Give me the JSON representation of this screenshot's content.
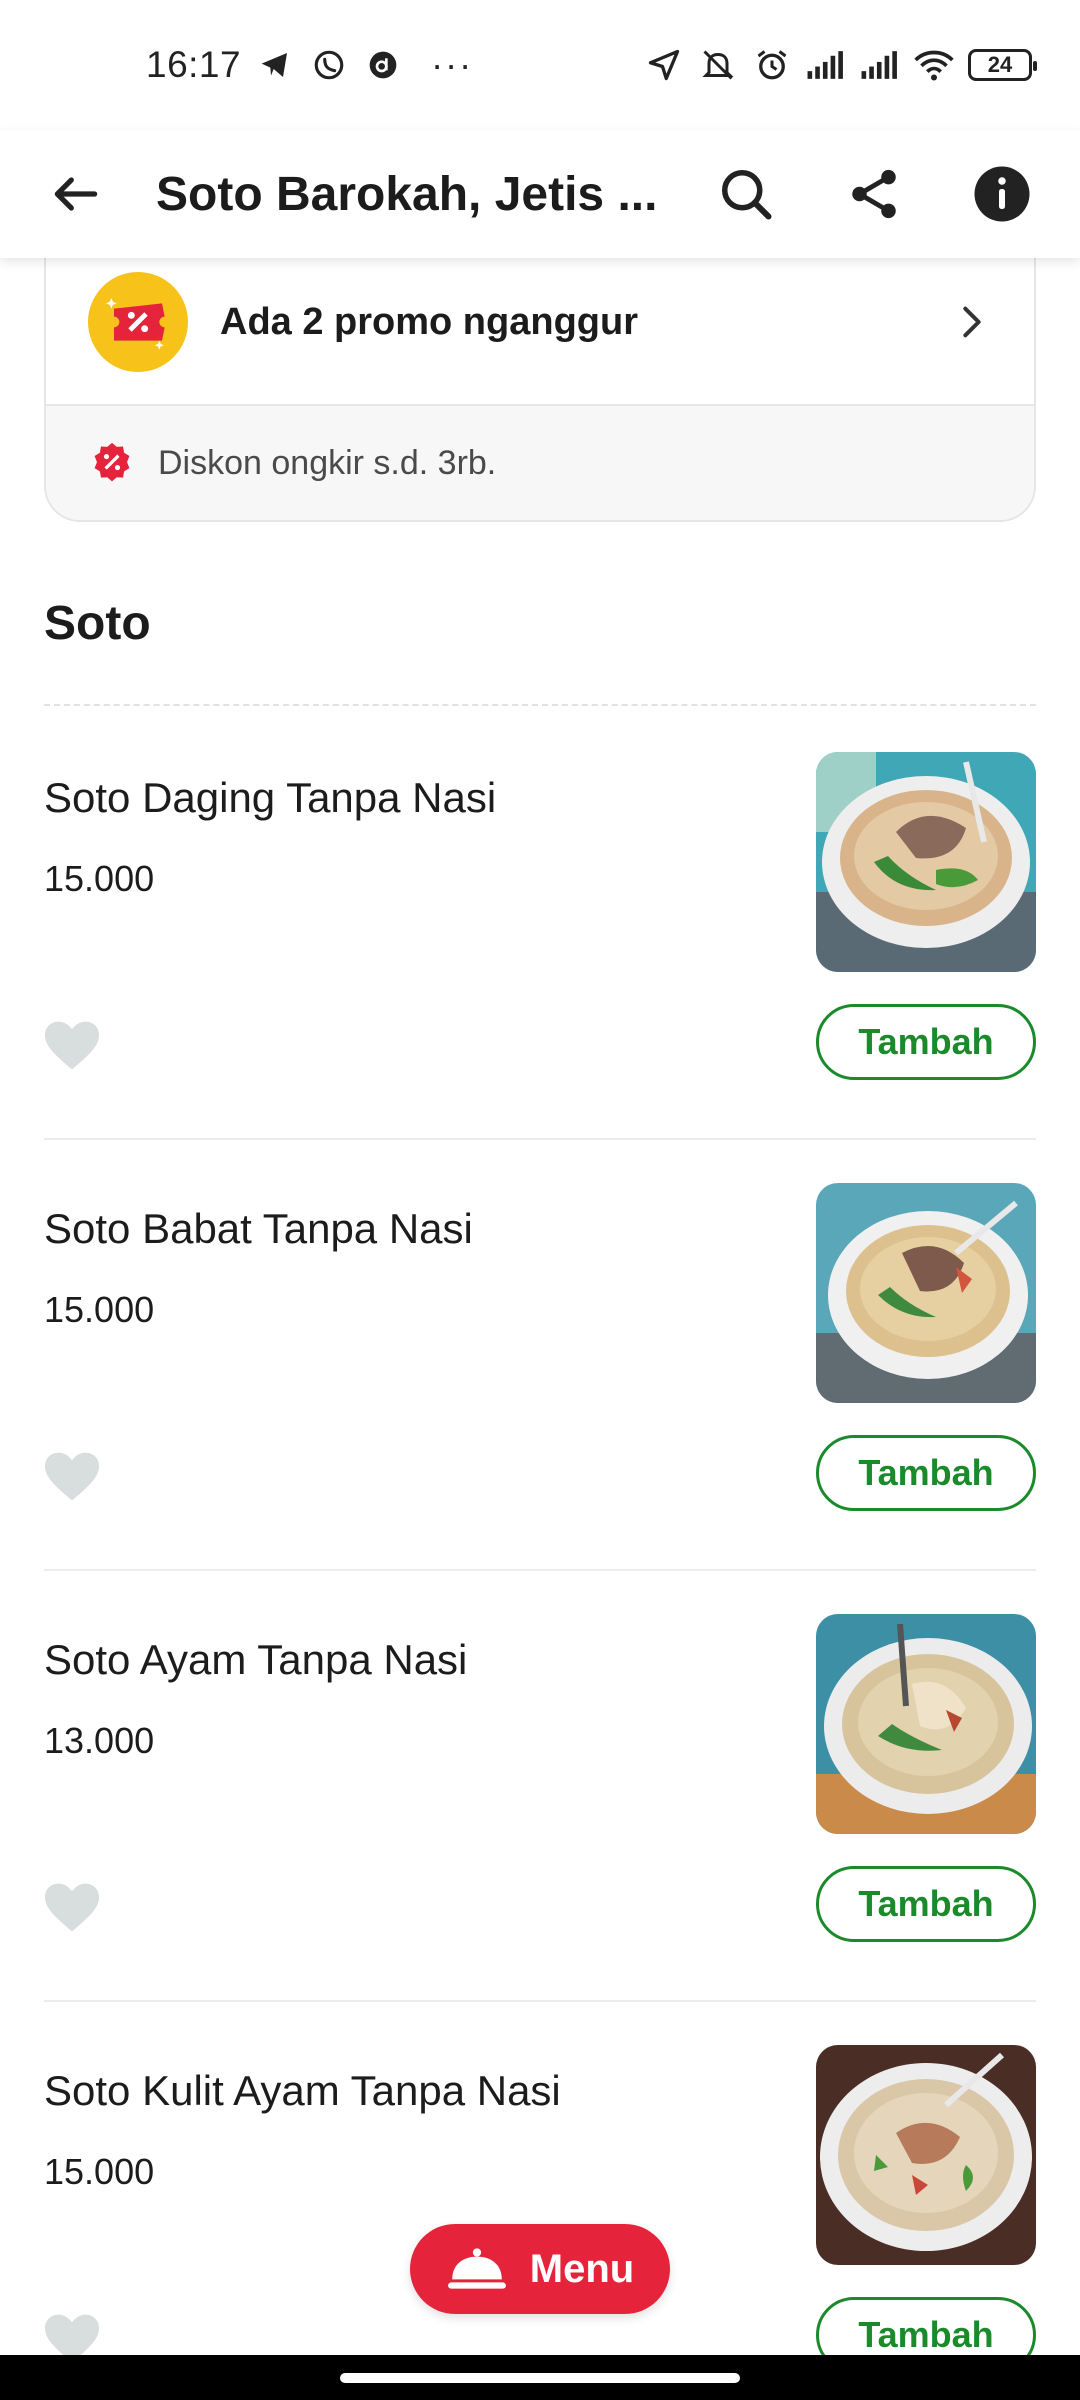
{
  "status_bar": {
    "time": "16:17",
    "notification_icons": [
      "telegram-icon",
      "whatsapp-icon",
      "dana-icon"
    ],
    "overflow": "···",
    "right_icons": [
      "location-arrow-icon",
      "bell-muted-icon",
      "alarm-icon",
      "signal-icon",
      "signal-icon",
      "wifi-icon"
    ],
    "battery": "24"
  },
  "header": {
    "title": "Soto Barokah, Jetis ...",
    "icons": [
      "back-arrow-icon",
      "search-icon",
      "share-icon",
      "info-icon"
    ]
  },
  "promo": {
    "label": "Ada 2 promo nganggur",
    "discount": "Diskon ongkir s.d. 3rb."
  },
  "section": {
    "title": "Soto"
  },
  "items": [
    {
      "name": "Soto Daging Tanpa Nasi",
      "price": "15.000",
      "add_label": "Tambah"
    },
    {
      "name": "Soto Babat Tanpa Nasi",
      "price": "15.000",
      "add_label": "Tambah"
    },
    {
      "name": "Soto Ayam Tanpa Nasi",
      "price": "13.000",
      "add_label": "Tambah"
    },
    {
      "name": "Soto Kulit Ayam Tanpa Nasi",
      "price": "15.000",
      "add_label": "Tambah"
    }
  ],
  "menu_button": {
    "label": "Menu"
  },
  "colors": {
    "brand_green": "#1a8a2a",
    "menu_red": "#e5243b",
    "promo_yellow": "#f7c21a",
    "discount_red": "#e5243b"
  }
}
